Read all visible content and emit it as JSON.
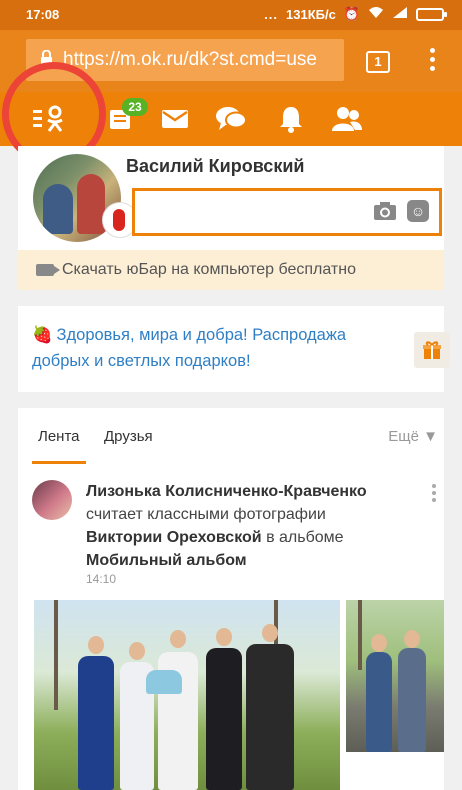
{
  "status_bar": {
    "time": "17:08",
    "dots": "...",
    "speed": "131КБ/с",
    "icons": [
      "alarm-icon",
      "wifi-icon",
      "signal-icon",
      "battery-icon"
    ]
  },
  "browser": {
    "url": "https://m.ok.ru/dk?st.cmd=use",
    "tab_count": "1"
  },
  "ok_toolbar": {
    "items": [
      "menu-icon",
      "feed-icon",
      "messages-icon",
      "discussions-icon",
      "notifications-icon",
      "friends-icon"
    ],
    "feed_badge": "23"
  },
  "profile": {
    "name": "Василий Кировский"
  },
  "download_bar": {
    "text": "Скачать юБар на компьютер бесплатно"
  },
  "promo": {
    "strawberry": "🍓",
    "text": "Здоровья, мира и добра! Распродажа добрых и светлых подарков!"
  },
  "feed_tabs": {
    "tabs": [
      "Лента",
      "Друзья"
    ],
    "more": "Ещё ▼"
  },
  "feed_item": {
    "author": "Лизонька Колисниченко-Кравченко",
    "action": "считает классными фотографии",
    "target": "Виктории Ореховской",
    "album_prefix": "в альбоме",
    "album": "Мобильный альбом",
    "time": "14:10"
  },
  "colors": {
    "ok_orange": "#ee8208",
    "status_bar": "#d86f0e",
    "link_blue": "#2f7fc5",
    "badge_green": "#57b324",
    "highlight_red": "#ec4436"
  }
}
